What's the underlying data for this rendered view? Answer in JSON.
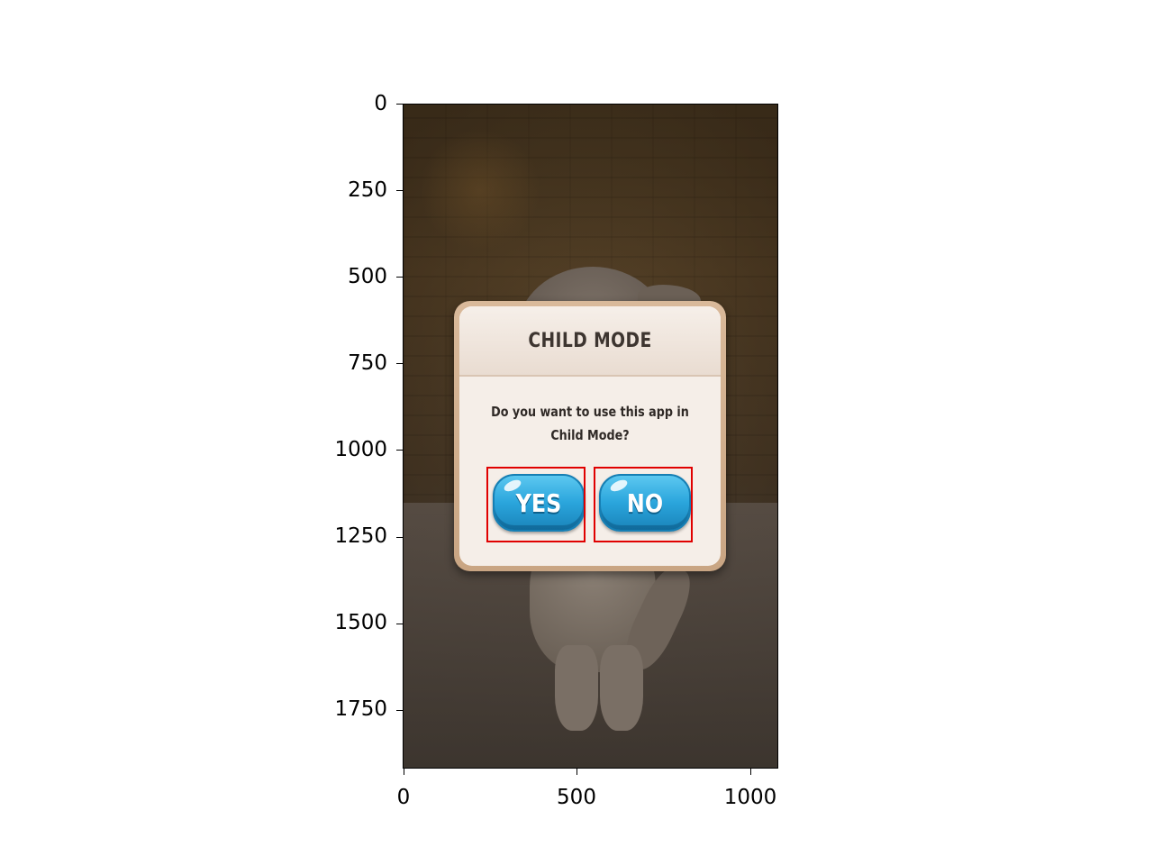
{
  "dialog": {
    "title": "CHILD MODE",
    "message_line1": "Do you want to use this app in",
    "message_line2": "Child Mode?",
    "yes_label": "YES",
    "no_label": "NO"
  },
  "axes": {
    "y_ticks": [
      "0",
      "250",
      "500",
      "750",
      "1000",
      "1250",
      "1500",
      "1750"
    ],
    "x_ticks": [
      "0",
      "500",
      "1000"
    ]
  },
  "colors": {
    "button_blue": "#2aa5dc",
    "highlight_red": "#e00000",
    "dialog_bg": "#f5eee8"
  },
  "icons": [
    "shine-highlight-icon"
  ]
}
